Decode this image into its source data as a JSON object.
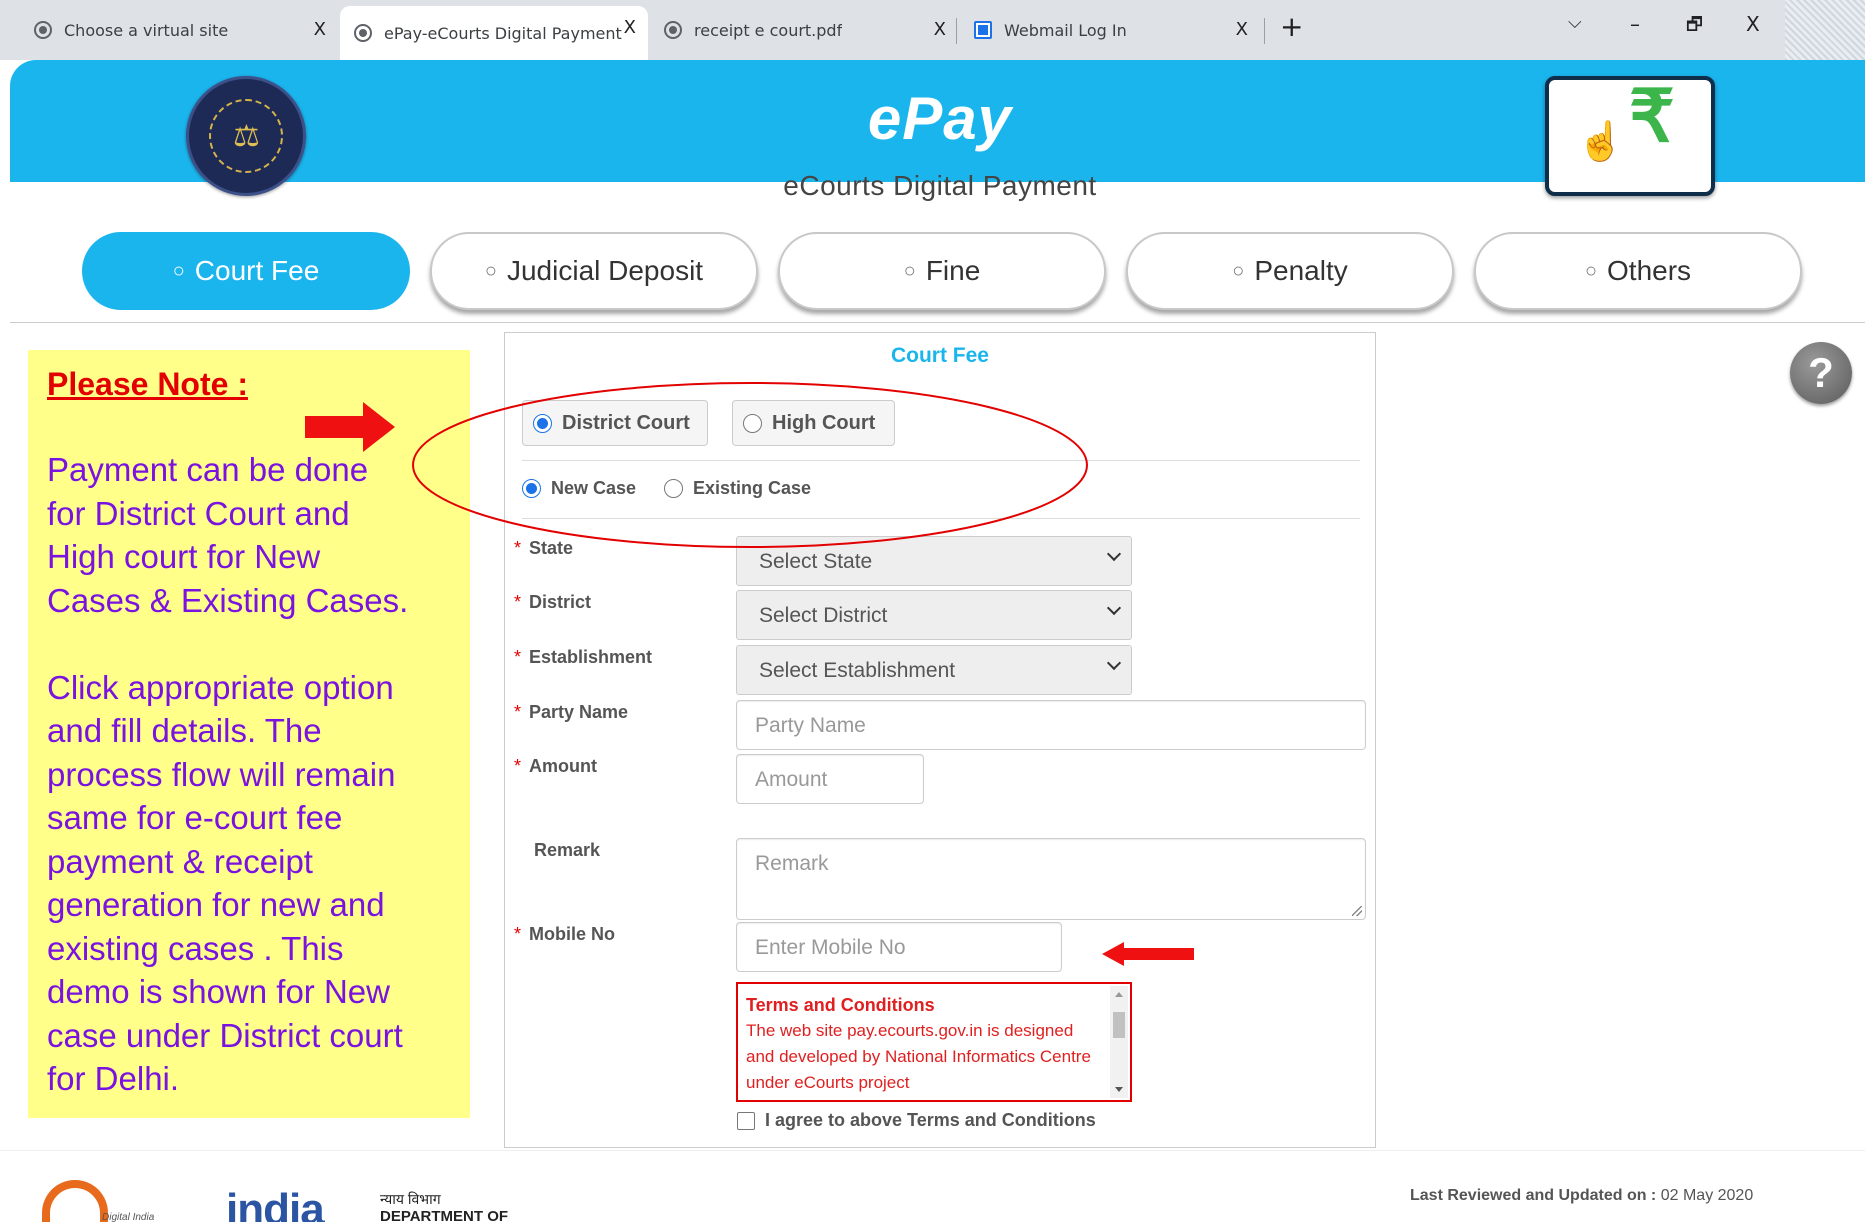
{
  "browser": {
    "tabs": [
      {
        "title": "Choose a virtual site",
        "active": false,
        "icon": "globe-icon"
      },
      {
        "title": "ePay-eCourts Digital Payment",
        "active": true,
        "icon": "globe-icon"
      },
      {
        "title": "receipt e court.pdf",
        "active": false,
        "icon": "globe-icon"
      },
      {
        "title": "Webmail Log In",
        "active": false,
        "icon": "webmail-icon"
      }
    ],
    "close_glyph": "X",
    "new_tab_glyph": "+",
    "window_controls": {
      "dropdown": "⌵",
      "minimize": "–",
      "restore": "🗗",
      "close": "X"
    }
  },
  "header": {
    "title": "ePay",
    "subtitle": "eCourts Digital Payment",
    "bg_color": "#1bb5ee"
  },
  "nav": {
    "items": [
      {
        "label": "Court Fee",
        "active": true
      },
      {
        "label": "Judicial Deposit",
        "active": false
      },
      {
        "label": "Fine",
        "active": false
      },
      {
        "label": "Penalty",
        "active": false
      },
      {
        "label": "Others",
        "active": false
      }
    ]
  },
  "note": {
    "title": "Please Note :",
    "text": "Payment can be done\nfor District Court and\nHigh court for New\nCases & Existing Cases.\n\nClick appropriate option\nand fill details. The\nprocess flow will remain\nsame for e-court fee\npayment & receipt\ngeneration for new and\nexisting cases . This\ndemo is shown for New\ncase under District court\nfor Delhi.",
    "bg_color": "#ffff8a",
    "text_color": "#7a12e0"
  },
  "form": {
    "title": "Court Fee",
    "court_type": {
      "options": [
        "District Court",
        "High Court"
      ],
      "selected": "District Court"
    },
    "case_type": {
      "options": [
        "New Case",
        "Existing Case"
      ],
      "selected": "New Case"
    },
    "required_marker": "*",
    "fields": {
      "state": {
        "label": "State",
        "value": "Select State"
      },
      "district": {
        "label": "District",
        "value": "Select District"
      },
      "establishment": {
        "label": "Establishment",
        "value": "Select Establishment"
      },
      "party_name": {
        "label": "Party Name",
        "placeholder": "Party Name"
      },
      "amount": {
        "label": "Amount",
        "placeholder": "Amount"
      },
      "remark": {
        "label": "Remark",
        "placeholder": "Remark"
      },
      "mobile": {
        "label": "Mobile No",
        "placeholder": "Enter Mobile No"
      }
    },
    "terms": {
      "title": "Terms and Conditions",
      "body": "The web site pay.ecourts.gov.in is designed and developed by National Informatics Centre under eCourts project"
    },
    "agree_label": "I agree to above Terms and Conditions"
  },
  "help": {
    "glyph": "?"
  },
  "footer": {
    "digital_india_text": "Digital India",
    "india_logo_text": "india",
    "dept_hindi": "न्याय विभाग",
    "dept_english": "DEPARTMENT OF",
    "reviewed_label": "Last Reviewed and Updated on :",
    "reviewed_date": "02 May 2020"
  }
}
